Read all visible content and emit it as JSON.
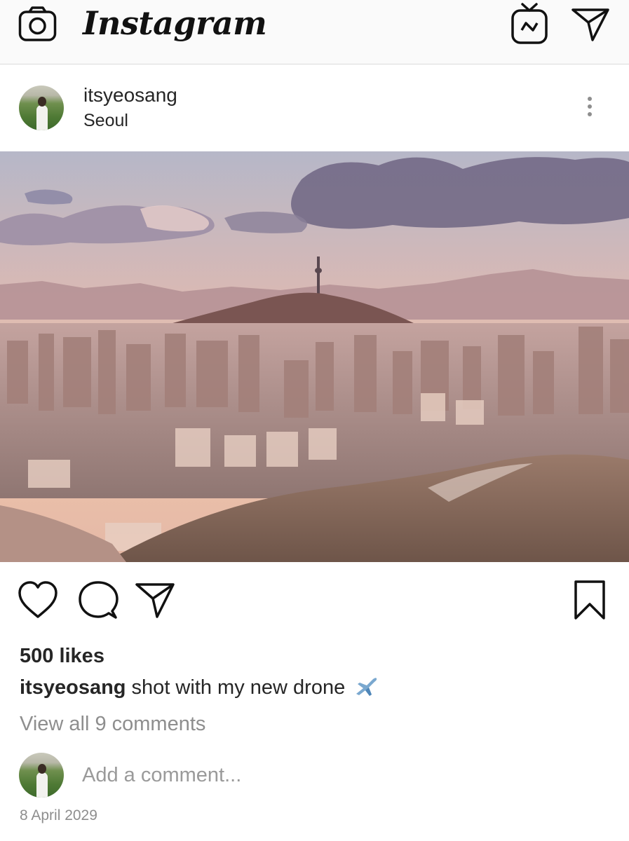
{
  "header": {
    "brand": "Instagram",
    "camera_icon": "camera-icon",
    "igtv_icon": "igtv-icon",
    "direct_icon": "paper-plane-icon"
  },
  "post": {
    "username": "itsyeosang",
    "location": "Seoul",
    "more_icon": "more-vertical-icon",
    "photo_subject": "Seoul skyline at sunset with N Seoul Tower on Namsan mountain",
    "likes": "500 likes",
    "caption_user": "itsyeosang",
    "caption_text": " shot with my new drone",
    "caption_emoji_icon": "airplane-emoji-icon",
    "view_comments": "View all 9 comments",
    "comment_placeholder": "Add a comment...",
    "date": "8 April 2029"
  },
  "actions": {
    "like_icon": "heart-icon",
    "comment_icon": "comment-icon",
    "share_icon": "paper-plane-icon",
    "save_icon": "bookmark-icon"
  },
  "colors": {
    "text": "#262626",
    "muted": "#8e8e8e",
    "header_bg": "#fafafa",
    "divider": "#dbdbdb"
  }
}
